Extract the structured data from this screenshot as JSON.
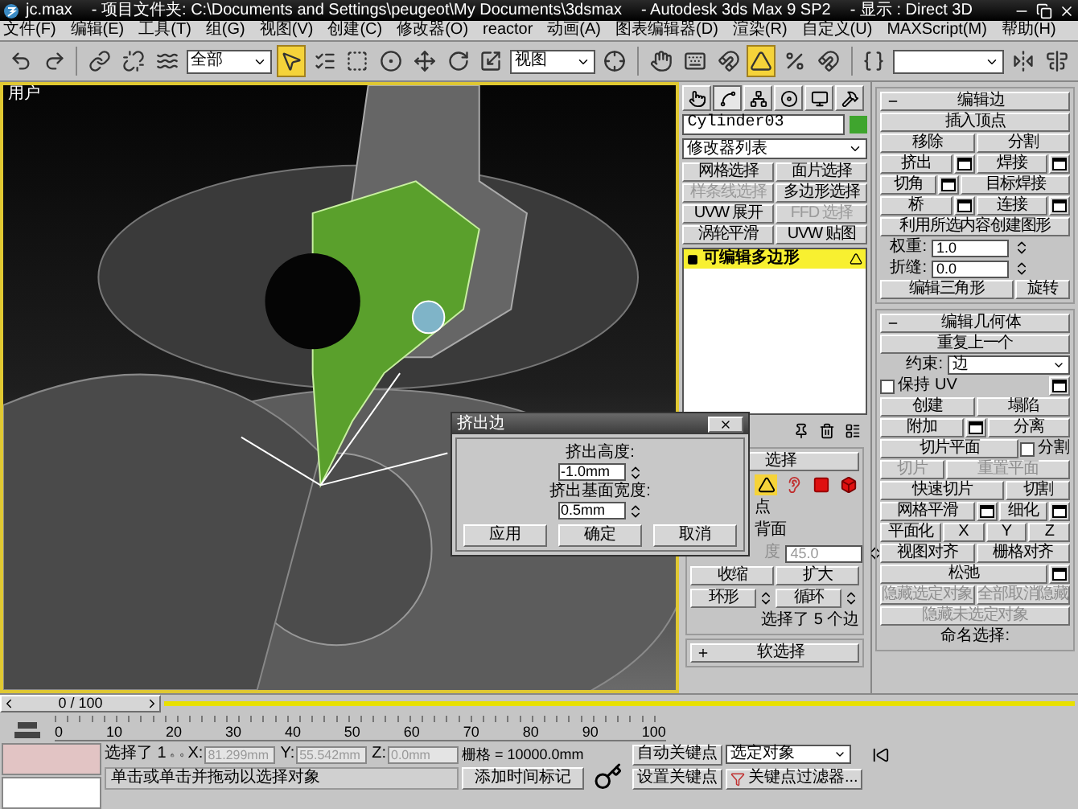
{
  "window": {
    "file": "jc.max",
    "project": "- 项目文件夹: C:\\Documents and Settings\\peugeot\\My Documents\\3dsmax",
    "app": "- Autodesk 3ds Max 9 SP2",
    "display": "- 显示 : Direct 3D"
  },
  "menu": [
    "文件(F)",
    "编辑(E)",
    "工具(T)",
    "组(G)",
    "视图(V)",
    "创建(C)",
    "修改器(O)",
    "reactor",
    "动画(A)",
    "图表编辑器(D)",
    "渲染(R)",
    "自定义(U)",
    "MAXScript(M)",
    "帮助(H)"
  ],
  "toolbar": [
    {
      "kind": "undo",
      "active": false
    },
    {
      "kind": "redo",
      "active": false
    },
    {
      "kind": "sep"
    },
    {
      "kind": "link",
      "active": false
    },
    {
      "kind": "unlink",
      "active": false
    },
    {
      "kind": "bind",
      "active": false
    },
    {
      "kind": "dropdown",
      "value": "全部"
    },
    {
      "kind": "select",
      "active": true
    },
    {
      "kind": "select-by-name",
      "active": false
    },
    {
      "kind": "region",
      "active": false
    },
    {
      "kind": "crossing",
      "active": false
    },
    {
      "kind": "move",
      "active": false
    },
    {
      "kind": "rotate",
      "active": false
    },
    {
      "kind": "scale",
      "active": false
    },
    {
      "kind": "dropdown",
      "value": "视图"
    },
    {
      "kind": "pivot",
      "active": false
    },
    {
      "kind": "sep"
    },
    {
      "kind": "manipulate",
      "active": false
    },
    {
      "kind": "keyboard",
      "active": false
    },
    {
      "kind": "snap",
      "active": false
    },
    {
      "kind": "angle-snap",
      "active": true
    },
    {
      "kind": "percent-snap",
      "active": false
    },
    {
      "kind": "spinner-snap",
      "active": false
    },
    {
      "kind": "sep"
    },
    {
      "kind": "named-sets",
      "active": false
    },
    {
      "kind": "dropdown"
    },
    {
      "kind": "mirror",
      "active": false
    },
    {
      "kind": "align",
      "active": false
    }
  ],
  "viewport": {
    "label": "用户"
  },
  "dialog": {
    "title": "挤出边",
    "fields": [
      {
        "label": "挤出高度:",
        "value": "-1.0mm"
      },
      {
        "label": "挤出基面宽度:",
        "value": "0.5mm"
      }
    ],
    "buttons": [
      "应用",
      "确定",
      "取消"
    ]
  },
  "command_panel": {
    "tabs": [
      {
        "kind": "create",
        "selected": false
      },
      {
        "kind": "modify",
        "selected": true
      },
      {
        "kind": "hierarchy",
        "selected": false
      },
      {
        "kind": "motion",
        "selected": false
      },
      {
        "kind": "display",
        "selected": false
      },
      {
        "kind": "utilities",
        "selected": false
      }
    ],
    "object": {
      "name": "Cylinder03",
      "color": "#3fa52e"
    },
    "modifier_list": "修改器列表",
    "modifier_buttons": [
      {
        "label": "网格选择",
        "disabled": false
      },
      {
        "label": "面片选择",
        "disabled": false
      },
      {
        "label": "样条线选择",
        "disabled": true
      },
      {
        "label": "多边形选择",
        "disabled": false
      },
      {
        "label": "UVW 展开",
        "disabled": false
      },
      {
        "label": "FFD 选择",
        "disabled": true
      },
      {
        "label": "涡轮平滑",
        "disabled": false
      },
      {
        "label": "UVW 贴图",
        "disabled": false
      }
    ],
    "stack": [
      {
        "label": "可编辑多边形",
        "selected": true
      }
    ],
    "selection": {
      "title": "选择",
      "expanded": true,
      "subobjects": [
        {
          "kind": "edge",
          "selected": true
        },
        {
          "kind": "border",
          "selected": false
        },
        {
          "kind": "polygon",
          "selected": false
        },
        {
          "kind": "element",
          "selected": false
        }
      ],
      "rows": [
        [
          {
            "kind": "text",
            "label": "点"
          }
        ],
        [
          {
            "kind": "text",
            "label": "背面"
          }
        ],
        [
          {
            "kind": "spinner",
            "label": "度",
            "value": "45.0",
            "disabled": true
          }
        ],
        [
          {
            "kind": "button",
            "label": "收缩",
            "disabled": false
          },
          {
            "kind": "button",
            "label": "扩大",
            "disabled": false
          }
        ],
        [
          {
            "kind": "button",
            "label": "环形",
            "disabled": false
          },
          {
            "kind": "arrows"
          },
          {
            "kind": "button",
            "label": "循环",
            "disabled": false
          },
          {
            "kind": "arrows"
          }
        ],
        [
          {
            "kind": "text",
            "label": "选择了 5 个边"
          }
        ]
      ]
    },
    "soft_selection": {
      "title": "软选择",
      "expanded": false
    },
    "edit_edges": {
      "title": "编辑边",
      "expanded": true,
      "rows": [
        [
          {
            "kind": "button",
            "label": "插入顶点",
            "disabled": false
          }
        ],
        [
          {
            "kind": "button",
            "label": "移除",
            "disabled": false
          },
          {
            "kind": "button",
            "label": "分割",
            "disabled": false
          }
        ],
        [
          {
            "kind": "button",
            "label": "挤出",
            "disabled": false
          },
          {
            "kind": "settings"
          },
          {
            "kind": "button",
            "label": "焊接",
            "disabled": false
          },
          {
            "kind": "settings"
          }
        ],
        [
          {
            "kind": "button",
            "label": "切角",
            "disabled": false
          },
          {
            "kind": "settings"
          },
          {
            "kind": "button",
            "label": "目标焊接",
            "disabled": false
          }
        ],
        [
          {
            "kind": "button",
            "label": "桥",
            "disabled": false
          },
          {
            "kind": "settings"
          },
          {
            "kind": "button",
            "label": "连接",
            "disabled": false
          },
          {
            "kind": "settings"
          }
        ],
        [
          {
            "kind": "button",
            "label": "利用所选内容创建图形",
            "disabled": false
          }
        ],
        [
          {
            "kind": "spinner",
            "label": "权重:",
            "value": "1.0",
            "disabled": false
          }
        ],
        [
          {
            "kind": "spinner",
            "label": "折缝:",
            "value": "0.0",
            "disabled": false
          }
        ],
        [
          {
            "kind": "button",
            "label": "编辑三角形",
            "disabled": false
          },
          {
            "kind": "button",
            "label": "旋转",
            "disabled": false
          }
        ]
      ]
    },
    "edit_geometry": {
      "title": "编辑几何体",
      "expanded": true,
      "rows": [
        [
          {
            "kind": "button",
            "label": "重复上一个",
            "disabled": false
          }
        ],
        [
          {
            "kind": "dropdown",
            "label": "约束:",
            "value": "边"
          }
        ],
        [
          {
            "kind": "checkbox",
            "label": "保持 UV",
            "checked": false
          },
          {
            "kind": "settings"
          }
        ],
        [
          {
            "kind": "button",
            "label": "创建",
            "disabled": false
          },
          {
            "kind": "button",
            "label": "塌陷",
            "disabled": false
          }
        ],
        [
          {
            "kind": "button",
            "label": "附加",
            "disabled": false
          },
          {
            "kind": "settings"
          },
          {
            "kind": "button",
            "label": "分离",
            "disabled": false
          }
        ],
        [
          {
            "kind": "button",
            "label": "切片平面",
            "disabled": false
          },
          {
            "kind": "checkbox",
            "label": "分割",
            "checked": false
          }
        ],
        [
          {
            "kind": "button",
            "label": "切片",
            "disabled": true
          },
          {
            "kind": "button",
            "label": "重置平面",
            "disabled": true
          }
        ],
        [
          {
            "kind": "button",
            "label": "快速切片",
            "disabled": false
          },
          {
            "kind": "button",
            "label": "切割",
            "disabled": false
          }
        ],
        [
          {
            "kind": "button",
            "label": "网格平滑",
            "disabled": false
          },
          {
            "kind": "settings"
          },
          {
            "kind": "button",
            "label": "细化",
            "disabled": false
          },
          {
            "kind": "settings"
          }
        ],
        [
          {
            "kind": "button",
            "label": "平面化",
            "disabled": false
          },
          {
            "kind": "button",
            "label": "X",
            "disabled": false
          },
          {
            "kind": "button",
            "label": "Y",
            "disabled": false
          },
          {
            "kind": "button",
            "label": "Z",
            "disabled": false
          }
        ],
        [
          {
            "kind": "button",
            "label": "视图对齐",
            "disabled": false
          },
          {
            "kind": "button",
            "label": "栅格对齐",
            "disabled": false
          }
        ],
        [
          {
            "kind": "button",
            "label": "松弛",
            "disabled": false
          },
          {
            "kind": "settings"
          }
        ],
        [
          {
            "kind": "button",
            "label": "隐藏选定对象",
            "disabled": true
          },
          {
            "kind": "button",
            "label": "全部取消隐藏",
            "disabled": true
          }
        ],
        [
          {
            "kind": "button",
            "label": "隐藏未选定对象",
            "disabled": true
          }
        ],
        [
          {
            "kind": "text",
            "label": "命名选择:"
          }
        ]
      ]
    }
  },
  "timeline": {
    "frame": "0 / 100",
    "ticks": [
      "0",
      "10",
      "20",
      "30",
      "40",
      "50",
      "60",
      "70",
      "80",
      "90",
      "100"
    ]
  },
  "status": {
    "selection": "选择了 1",
    "coords": [
      {
        "axis": "X:",
        "value": "81.299mm",
        "disabled": true
      },
      {
        "axis": "Y:",
        "value": "55.542mm",
        "disabled": true
      },
      {
        "axis": "Z:",
        "value": "0.0mm",
        "disabled": true
      }
    ],
    "grid": "栅格 = 10000.0mm",
    "auto_key": "自动关键点",
    "key_mode": "选定对象",
    "set_key": "设置关键点",
    "key_filters": "关键点过滤器...",
    "prompt": "单击或单击并拖动以选择对象",
    "add_time_tag": "添加时间标记"
  }
}
